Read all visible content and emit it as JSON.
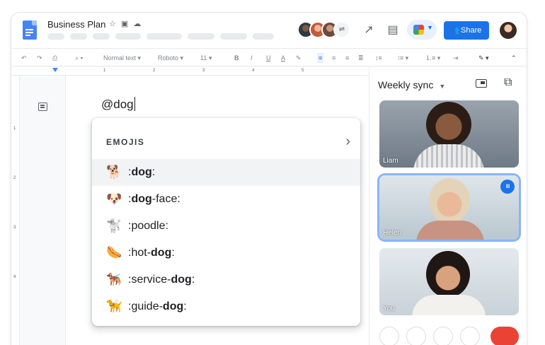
{
  "document": {
    "title": "Business Plan",
    "typed_text": "@dog"
  },
  "header": {
    "share_label": "Share",
    "title_icons": "☆ ▣ ☁"
  },
  "toolbar": {
    "style": "Normal text",
    "font": "Roboto",
    "size": "11"
  },
  "ruler": {
    "numbers": [
      "1",
      "2",
      "3",
      "4",
      "5"
    ]
  },
  "ruler_v": {
    "numbers": [
      "1",
      "2",
      "3",
      "4"
    ]
  },
  "popup": {
    "heading": "EMOJIS",
    "items": [
      {
        "emoji": "🐕",
        "pre": ":",
        "bold": "dog",
        "post": ":"
      },
      {
        "emoji": "🐶",
        "pre": ":",
        "bold": "dog",
        "post": "-face:"
      },
      {
        "emoji": "🐩",
        "pre": ":poodle:",
        "bold": "",
        "post": ""
      },
      {
        "emoji": "🌭",
        "pre": ":hot-",
        "bold": "dog",
        "post": ":"
      },
      {
        "emoji": "🐕‍🦺",
        "pre": ":service-",
        "bold": "dog",
        "post": ":"
      },
      {
        "emoji": "🦮",
        "pre": ":guide-",
        "bold": "dog",
        "post": ":"
      }
    ]
  },
  "meet": {
    "title": "Weekly sync",
    "participants": [
      {
        "name": "Liam"
      },
      {
        "name": "Helen"
      },
      {
        "name": "You"
      }
    ]
  },
  "colors": {
    "accent": "#1a73e8",
    "doc_blue": "#4285f4",
    "end_call": "#ea4335"
  },
  "icons": [
    "doc-icon",
    "star-icon",
    "move-folder-icon",
    "cloud-saved-icon",
    "trending-icon",
    "comment-icon",
    "meet-icon",
    "share-people-icon",
    "undo-icon",
    "redo-icon",
    "print-icon",
    "zoom-icon",
    "bold-icon",
    "italic-icon",
    "underline-icon",
    "text-color-icon",
    "highlight-icon",
    "align-left-icon",
    "align-center-icon",
    "align-right-icon",
    "justify-icon",
    "line-spacing-icon",
    "bullets-icon",
    "numbered-list-icon",
    "edit-mode-icon",
    "collapse-icon",
    "outline-icon",
    "chevron-right-icon",
    "pip-icon",
    "pop-out-icon",
    "speaking-icon"
  ]
}
